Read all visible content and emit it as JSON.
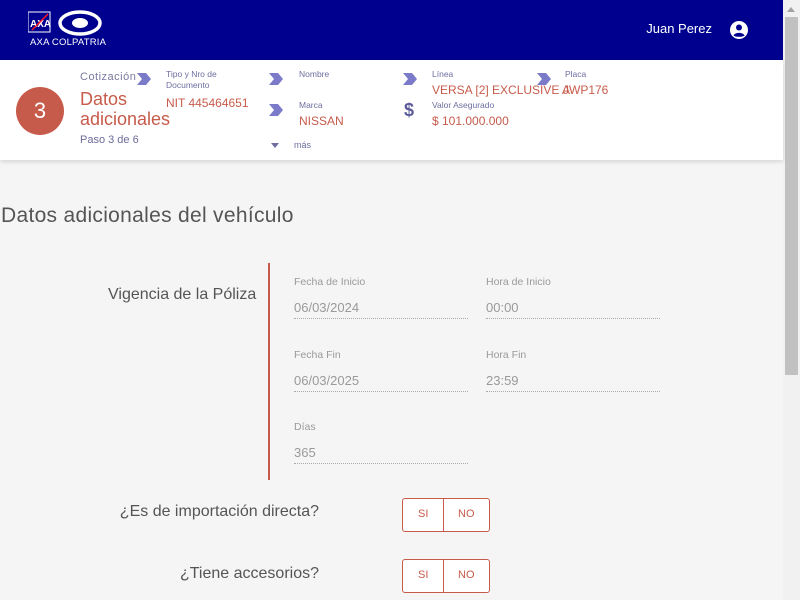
{
  "header": {
    "brand": "AXA COLPATRIA",
    "username": "Juan Perez",
    "brand_color": "#00008f"
  },
  "summary": {
    "step_number": "3",
    "cotizacion_label": "Cotización",
    "step_title": "Datos adicionales",
    "step_subtitle": "Paso 3 de 6",
    "fields": {
      "documento_label": "Tipo y Nro de Documento",
      "documento_value": "NIT 445464651",
      "nombre_label": "Nombre",
      "nombre_value": "",
      "marca_label": "Marca",
      "marca_value": "NISSAN",
      "linea_label": "Línea",
      "linea_value": "VERSA [2] EXCLUSIVE A",
      "placa_label": "Placa",
      "placa_value": "JWP176",
      "valor_label": "Valor Asegurado",
      "valor_value": "$ 101.000.000"
    },
    "more_label": "más",
    "accent_color": "#c75b4b"
  },
  "main": {
    "section_title": "Datos adicionales del vehículo",
    "vigencia_label": "Vigencia de la Póliza",
    "vigencia": {
      "fecha_inicio_label": "Fecha de Inicio",
      "fecha_inicio_value": "06/03/2024",
      "hora_inicio_label": "Hora de Inicio",
      "hora_inicio_value": "00:00",
      "fecha_fin_label": "Fecha Fin",
      "fecha_fin_value": "06/03/2025",
      "hora_fin_label": "Hora Fin",
      "hora_fin_value": "23:59",
      "dias_label": "Días",
      "dias_value": "365"
    },
    "questions": [
      {
        "text": "¿Es de importación directa?",
        "yes": "SI",
        "no": "NO"
      },
      {
        "text": "¿Tiene accesorios?",
        "yes": "SI",
        "no": "NO"
      }
    ]
  }
}
